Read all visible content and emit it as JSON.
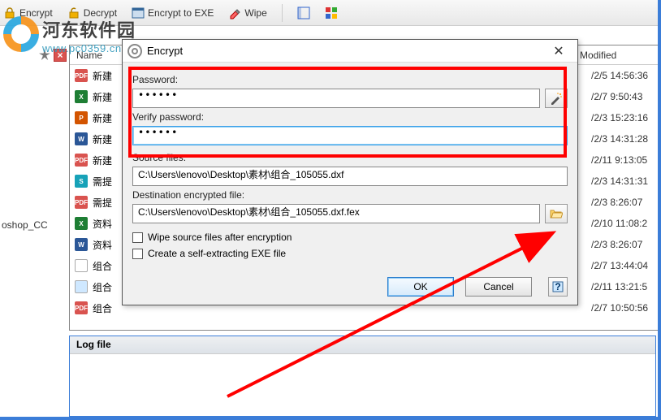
{
  "watermark": {
    "cn": "河东软件园",
    "url": "www.pc0359.cn"
  },
  "toolbar": {
    "encrypt": "Encrypt",
    "decrypt": "Decrypt",
    "encrypt_exe": "Encrypt to EXE",
    "wipe": "Wipe"
  },
  "sidebar_label": "oshop_CC",
  "columns": {
    "name": "Name",
    "modified": "Modified"
  },
  "files": [
    {
      "ico": "pdf",
      "bg": "#d9534f",
      "txt": "PDF",
      "name": "新建",
      "mod": "/2/5 14:56:36"
    },
    {
      "ico": "xls",
      "bg": "#1e7e34",
      "txt": "X",
      "name": "新建",
      "mod": "/2/7 9:50:43"
    },
    {
      "ico": "ppt",
      "bg": "#d35400",
      "txt": "P",
      "name": "新建",
      "mod": "/2/3 15:23:16"
    },
    {
      "ico": "doc",
      "bg": "#2b5797",
      "txt": "W",
      "name": "新建",
      "mod": "/2/3 14:31:28"
    },
    {
      "ico": "pdf",
      "bg": "#d9534f",
      "txt": "PDF",
      "name": "新建",
      "mod": "/2/11 9:13:05"
    },
    {
      "ico": "sync",
      "bg": "#17a2b8",
      "txt": "S",
      "name": "需提",
      "mod": "/2/3 14:31:31"
    },
    {
      "ico": "pdf",
      "bg": "#d9534f",
      "txt": "PDF",
      "name": "需提",
      "mod": "/2/3 8:26:07"
    },
    {
      "ico": "xls",
      "bg": "#1e7e34",
      "txt": "X",
      "name": "资料",
      "mod": "/2/10 11:08:2"
    },
    {
      "ico": "doc",
      "bg": "#2b5797",
      "txt": "W",
      "name": "资料",
      "mod": "/2/3 8:26:07"
    },
    {
      "ico": "file",
      "bg": "#ffffff",
      "txt": "",
      "name": "组合",
      "mod": "/2/7 13:44:04"
    },
    {
      "ico": "file",
      "bg": "#cfe8ff",
      "txt": "",
      "name": "组合",
      "mod": "/2/11 13:21:5"
    },
    {
      "ico": "pdf",
      "bg": "#d9534f",
      "txt": "PDF",
      "name": "组合",
      "mod": "/2/7 10:50:56"
    }
  ],
  "dialog": {
    "title": "Encrypt",
    "password_label": "Password:",
    "password_value": "••••••",
    "verify_label": "Verify password:",
    "verify_value": "••••••",
    "source_label": "Source files:",
    "source_value": "C:\\Users\\lenovo\\Desktop\\素材\\组合_105055.dxf",
    "dest_label": "Destination encrypted file:",
    "dest_value": "C:\\Users\\lenovo\\Desktop\\素材\\组合_105055.dxf.fex",
    "wipe_label": "Wipe source files after encryption",
    "selfexe_label": "Create a self-extracting EXE file",
    "ok": "OK",
    "cancel": "Cancel",
    "help": "?"
  },
  "log": {
    "title": "Log file"
  }
}
